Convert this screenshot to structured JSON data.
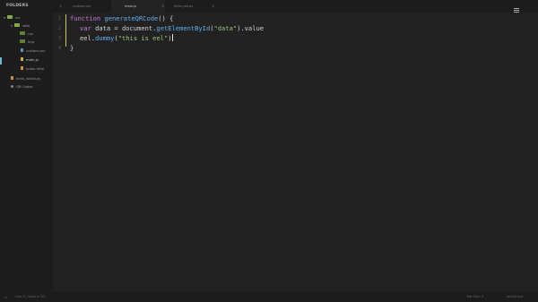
{
  "sidebar": {
    "title": "FOLDERS",
    "root_folder": "src",
    "sub_folder": "web",
    "items": [
      {
        "label": "css",
        "type": "folder"
      },
      {
        "label": "img",
        "type": "folder"
      },
      {
        "label": "custom.css",
        "type": "file"
      },
      {
        "label": "main.js",
        "type": "file"
      },
      {
        "label": "index.html",
        "type": "file"
      }
    ],
    "extra": [
      {
        "label": "hello_world.py"
      },
      {
        "label": "QR Codes"
      }
    ]
  },
  "tabs": [
    {
      "label": "custom.css",
      "active": false
    },
    {
      "label": "main.js",
      "active": true
    },
    {
      "label": "hello_eel.py",
      "active": false
    }
  ],
  "editor": {
    "line_numbers": [
      "1",
      "2",
      "3",
      "4"
    ],
    "line1": {
      "kw": "function",
      "fn": "generateQRCode",
      "rest": "() {"
    },
    "line2": {
      "kw": "var",
      "var": " data = ",
      "obj": "document.",
      "method": "getElementById",
      "open": "(",
      "str": "\"data\"",
      "tail": ").value"
    },
    "line3": {
      "obj": "eel.",
      "method": "dummy",
      "open": "(",
      "str": "\"this is eel\"",
      "close": ")"
    },
    "line4": {
      "brace": "}"
    }
  },
  "status": {
    "left": "Line 4, Column 30",
    "right1": "Tab Size: 4",
    "right2": "JavaScript"
  },
  "colors": {
    "background": "#222222",
    "keyword": "#c678dd",
    "function": "#61afef",
    "string": "#98c379",
    "modified_marker": "#c7c253"
  }
}
